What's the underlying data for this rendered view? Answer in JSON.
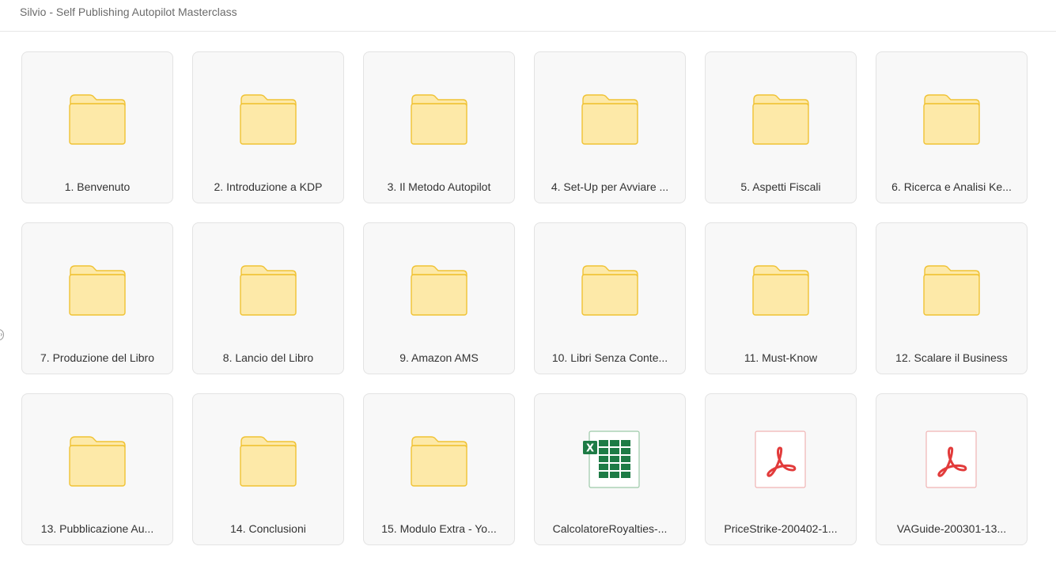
{
  "header": {
    "title": "Silvio - Self Publishing Autopilot Masterclass"
  },
  "items": [
    {
      "type": "folder",
      "label": "1. Benvenuto",
      "icon": "folder-icon"
    },
    {
      "type": "folder",
      "label": "2. Introduzione a KDP",
      "icon": "folder-icon"
    },
    {
      "type": "folder",
      "label": "3. Il Metodo Autopilot",
      "icon": "folder-icon"
    },
    {
      "type": "folder",
      "label": "4. Set-Up per Avviare ...",
      "icon": "folder-icon"
    },
    {
      "type": "folder",
      "label": "5. Aspetti Fiscali",
      "icon": "folder-icon"
    },
    {
      "type": "folder",
      "label": "6. Ricerca e Analisi Ke...",
      "icon": "folder-icon"
    },
    {
      "type": "folder",
      "label": "7. Produzione del Libro",
      "icon": "folder-icon"
    },
    {
      "type": "folder",
      "label": "8. Lancio del Libro",
      "icon": "folder-icon"
    },
    {
      "type": "folder",
      "label": "9. Amazon AMS",
      "icon": "folder-icon"
    },
    {
      "type": "folder",
      "label": "10. Libri Senza Conte...",
      "icon": "folder-icon"
    },
    {
      "type": "folder",
      "label": "11. Must-Know",
      "icon": "folder-icon"
    },
    {
      "type": "folder",
      "label": "12. Scalare il Business",
      "icon": "folder-icon"
    },
    {
      "type": "folder",
      "label": "13. Pubblicazione Au...",
      "icon": "folder-icon"
    },
    {
      "type": "folder",
      "label": "14. Conclusioni",
      "icon": "folder-icon"
    },
    {
      "type": "folder",
      "label": "15. Modulo Extra - Yo...",
      "icon": "folder-icon"
    },
    {
      "type": "excel",
      "label": "CalcolatoreRoyalties-...",
      "icon": "excel-file-icon"
    },
    {
      "type": "pdf",
      "label": "PriceStrike-200402-1...",
      "icon": "pdf-file-icon"
    },
    {
      "type": "pdf",
      "label": "VAGuide-200301-13...",
      "icon": "pdf-file-icon"
    }
  ],
  "colors": {
    "folder_fill": "#FDE9A8",
    "folder_stroke": "#F0C233",
    "excel_green": "#1D7B45",
    "pdf_red": "#E23B3B"
  }
}
